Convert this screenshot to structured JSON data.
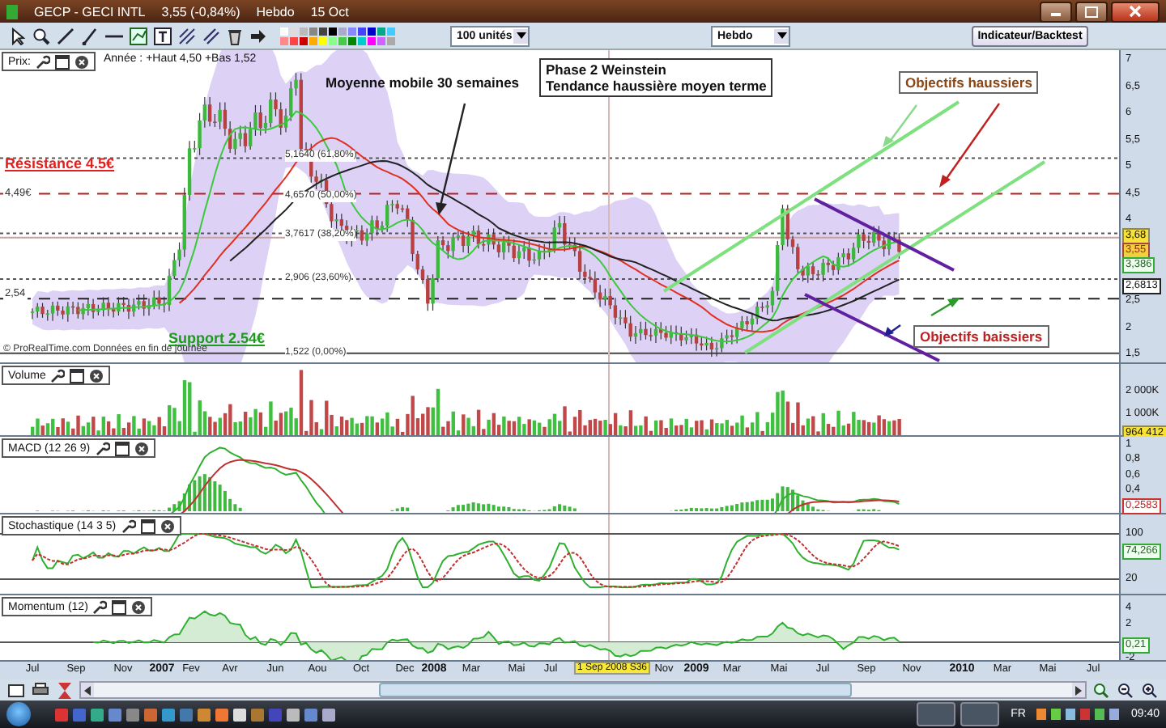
{
  "window": {
    "title": "GECP - GECI INTL",
    "quote": "3,55 (-0,84%)",
    "period": "Hebdo",
    "date": "15 Oct"
  },
  "toolbar": {
    "units": "100 unités",
    "timeframe": "Hebdo",
    "button": "Indicateur/Backtest"
  },
  "price_panel": {
    "title": "Prix:",
    "info": "Année : +Haut 4,50 +Bas 1,52",
    "yticks": [
      "7",
      "6,5",
      "6",
      "5,5",
      "5",
      "4,5",
      "4",
      "2,5",
      "2",
      "1,5"
    ],
    "value_badges": [
      {
        "text": "3,68",
        "kind": "last"
      },
      {
        "text": "3,55",
        "kind": "close"
      },
      {
        "text": "3,386",
        "kind": "average"
      },
      {
        "text": "2,6813",
        "kind": "level"
      }
    ],
    "fib_labels": [
      "5,1640 (61,80%)",
      "4,6570 (50,00%)",
      "3,7617 (38,20%)",
      "2,906 (23,60%)",
      "1,522 (0,00%)"
    ],
    "annotations": [
      {
        "text": "Résistance 4.5€",
        "kind": "underlined",
        "color": "#e02020"
      },
      {
        "text": "4,49€",
        "kind": "small",
        "color": "#333333"
      },
      {
        "text": "2,54",
        "kind": "small",
        "color": "#333333"
      },
      {
        "text": "Support 2.54€",
        "kind": "underlined",
        "color": "#1e9a1e"
      },
      {
        "text": "Moyenne mobile 30 semaines",
        "kind": "plain",
        "color": "#111111"
      },
      {
        "text": "Objectifs haussiers",
        "kind": "boxed",
        "color": "#8b4513"
      },
      {
        "text": "Objectifs baissiers",
        "kind": "boxed",
        "color": "#c02020"
      }
    ],
    "note": {
      "lines": [
        "Phase 2 Weinstein",
        "Tendance haussière moyen terme"
      ]
    },
    "credit": "© ProRealTime.com  Données en fin de journée"
  },
  "indicators": [
    {
      "kind": "volume",
      "title": "Volume",
      "yticks": [
        "2 000K",
        "1 000K"
      ],
      "badges": [
        {
          "text": "964 412",
          "kind": "last"
        }
      ]
    },
    {
      "kind": "macd",
      "title": "MACD (12 26 9)",
      "yticks": [
        "1",
        "0,8",
        "0,6",
        "0,4"
      ],
      "badges": [
        {
          "text": "0,2583",
          "kind": "signal"
        }
      ]
    },
    {
      "kind": "stochastic",
      "title": "Stochastique (14 3 5)",
      "yticks": [
        "100",
        "20"
      ],
      "badges": [
        {
          "text": "74,266",
          "kind": "average"
        }
      ]
    },
    {
      "kind": "momentum",
      "title": "Momentum (12)",
      "yticks": [
        "4",
        "2",
        "-2"
      ],
      "badges": [
        {
          "text": "0,21",
          "kind": "average"
        }
      ]
    }
  ],
  "x_axis": [
    {
      "label": "Jul",
      "kind": "month"
    },
    {
      "label": "Sep",
      "kind": "month"
    },
    {
      "label": "Nov",
      "kind": "month"
    },
    {
      "label": "2007",
      "kind": "year"
    },
    {
      "label": "Fev",
      "kind": "month"
    },
    {
      "label": "Avr",
      "kind": "month"
    },
    {
      "label": "Jun",
      "kind": "month"
    },
    {
      "label": "Aou",
      "kind": "month"
    },
    {
      "label": "Oct",
      "kind": "month"
    },
    {
      "label": "Dec",
      "kind": "month"
    },
    {
      "label": "2008",
      "kind": "year"
    },
    {
      "label": "Mar",
      "kind": "month"
    },
    {
      "label": "Mai",
      "kind": "month"
    },
    {
      "label": "Jul",
      "kind": "month"
    },
    {
      "label": "1 Sep 2008 S36",
      "kind": "cursor"
    },
    {
      "label": "Nov",
      "kind": "month"
    },
    {
      "label": "2009",
      "kind": "year"
    },
    {
      "label": "Mar",
      "kind": "month"
    },
    {
      "label": "Mai",
      "kind": "month"
    },
    {
      "label": "Jul",
      "kind": "month"
    },
    {
      "label": "Sep",
      "kind": "month"
    },
    {
      "label": "Nov",
      "kind": "month"
    },
    {
      "label": "2010",
      "kind": "year"
    },
    {
      "label": "Mar",
      "kind": "month"
    },
    {
      "label": "Mai",
      "kind": "month"
    },
    {
      "label": "Jul",
      "kind": "month"
    }
  ],
  "taskbar": {
    "language": "FR",
    "time": "09:40"
  }
}
